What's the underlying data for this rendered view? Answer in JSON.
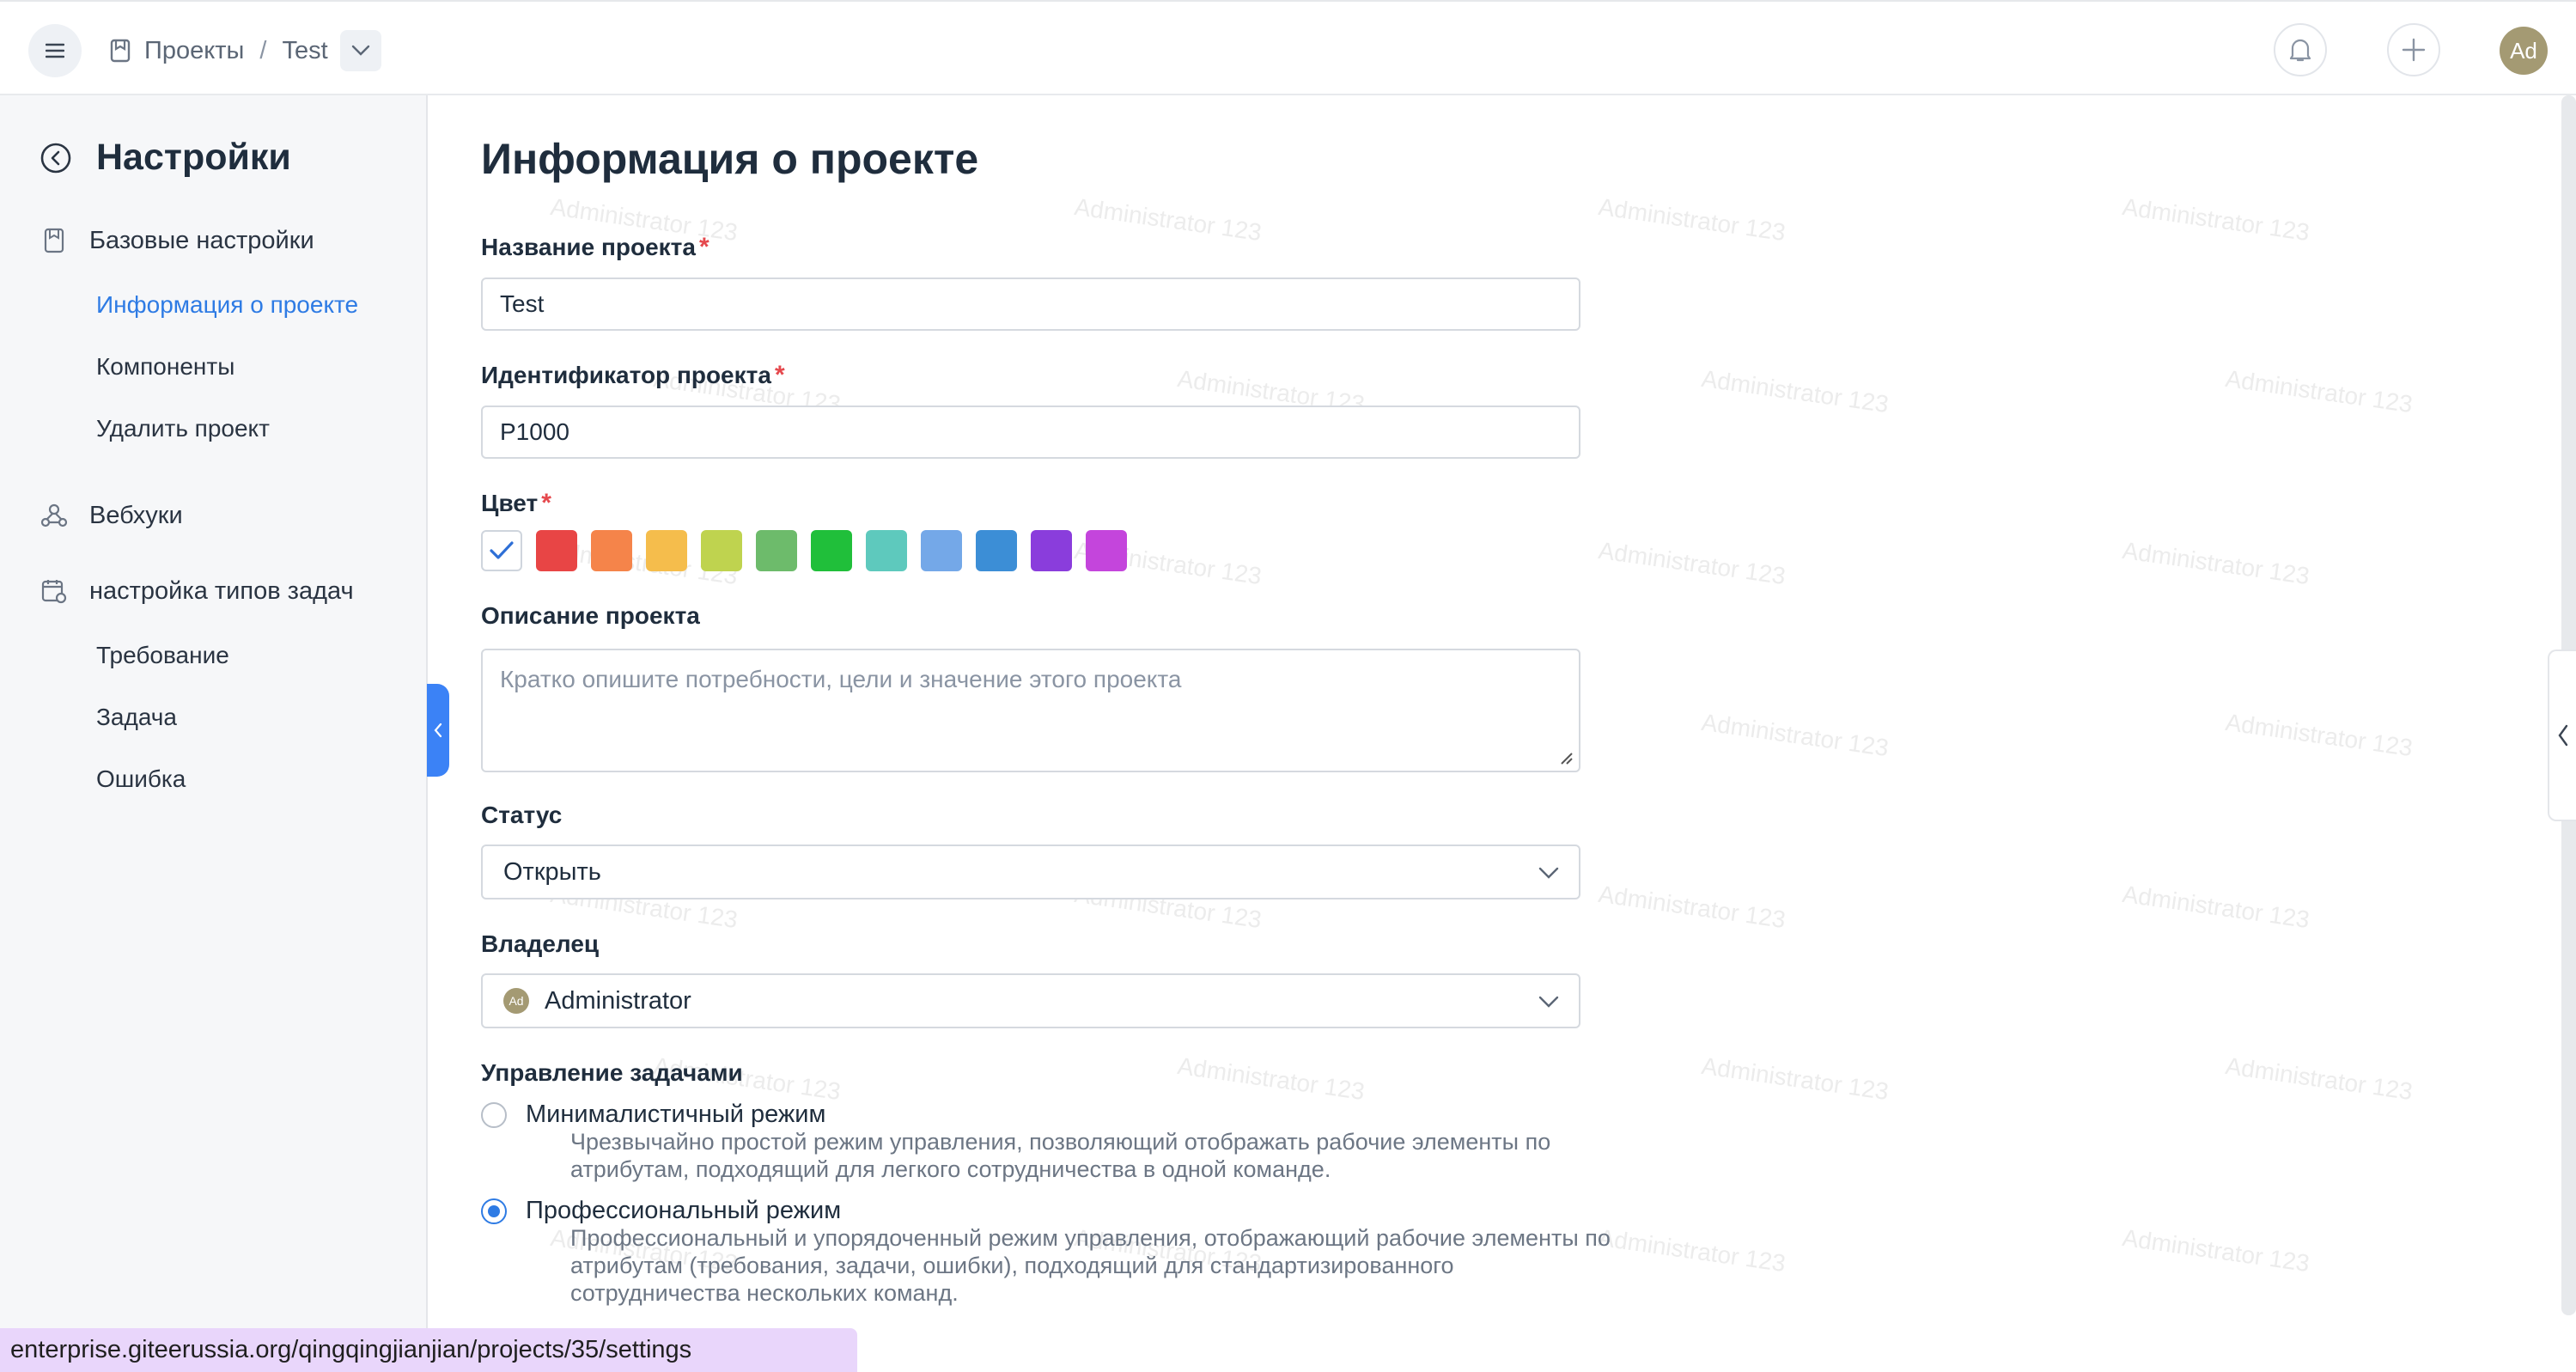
{
  "header": {
    "breadcrumb_projects": "Проекты",
    "breadcrumb_sep": "/",
    "breadcrumb_current": "Test",
    "avatar_initials": "Ad"
  },
  "sidebar": {
    "title": "Настройки",
    "sections": {
      "basic": "Базовые настройки",
      "project_info": "Информация о проекте",
      "components": "Компоненты",
      "delete_project": "Удалить проект",
      "webhooks": "Вебхуки",
      "task_types": "настройка типов задач",
      "requirement": "Требование",
      "task": "Задача",
      "bug": "Ошибка"
    }
  },
  "form": {
    "page_title": "Информация о проекте",
    "name_label": "Название проекта",
    "name_value": "Test",
    "id_label": "Идентификатор проекта",
    "id_value": "P1000",
    "color_label": "Цвет",
    "colors": [
      "#ffffff",
      "#e84545",
      "#f5844a",
      "#f5bd4c",
      "#bfd34f",
      "#6dbb6b",
      "#20bf3a",
      "#5ec9bd",
      "#74a8e8",
      "#3c8ed6",
      "#8a3ddc",
      "#c445dc"
    ],
    "selected_color_index": 0,
    "description_label": "Описание проекта",
    "description_placeholder": "Кратко опишите потребности, цели и значение этого проекта",
    "status_label": "Статус",
    "status_value": "Открыть",
    "owner_label": "Владелец",
    "owner_value": "Administrator",
    "owner_avatar": "Ad",
    "task_mgmt_label": "Управление задачами",
    "minimal_mode_label": "Минималистичный режим",
    "minimal_mode_desc": "Чрезвычайно простой режим управления, позволяющий отображать рабочие элементы по атрибутам, подходящий для легкого сотрудничества в одной команде.",
    "pro_mode_label": "Профессиональный режим",
    "pro_mode_desc": "Профессиональный и упорядоченный режим управления, отображающий рабочие элементы по атрибутам (требования, задачи, ошибки), подходящий для стандартизированного сотрудничества нескольких команд.",
    "selected_mode": "pro"
  },
  "status_url": "enterprise.giteerussia.org/qingqingjianjian/projects/35/settings",
  "watermark": "Administrator 123"
}
